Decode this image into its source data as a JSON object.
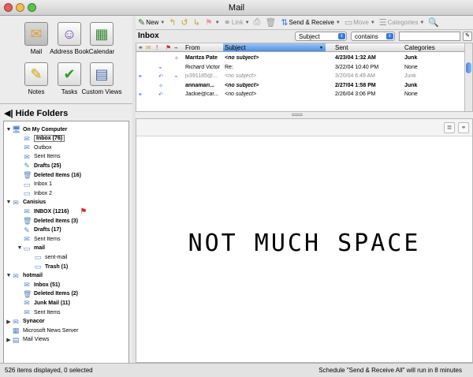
{
  "window": {
    "title": "Mail"
  },
  "apps": [
    {
      "label": "Mail",
      "icon": "inbox-icon",
      "selected": true
    },
    {
      "label": "Address Book",
      "icon": "address-book-icon"
    },
    {
      "label": "Calendar",
      "icon": "calendar-icon"
    },
    {
      "label": "Notes",
      "icon": "notes-icon"
    },
    {
      "label": "Tasks",
      "icon": "tasks-icon"
    },
    {
      "label": "Custom Views",
      "icon": "custom-views-icon"
    }
  ],
  "sidebar": {
    "hide_folders": "Hide Folders",
    "folders": [
      {
        "label": "On My Computer",
        "bold": true,
        "triangle": "▼"
      },
      {
        "label": "Inbox (76)",
        "bold": true,
        "selected": true
      },
      {
        "label": "Outbox"
      },
      {
        "label": "Sent Items"
      },
      {
        "label": "Drafts (25)",
        "bold": true
      },
      {
        "label": "Deleted Items (16)",
        "bold": true
      },
      {
        "label": "Inbox 1"
      },
      {
        "label": "Inbox 2"
      },
      {
        "label": "Canisius",
        "bold": true,
        "triangle": "▼"
      },
      {
        "label": "INBOX (1216)",
        "bold": true,
        "flag": true
      },
      {
        "label": "Deleted Items (3)",
        "bold": true
      },
      {
        "label": "Drafts (17)",
        "bold": true
      },
      {
        "label": "Sent Items"
      },
      {
        "label": "mail",
        "bold": true,
        "triangle": "▼"
      },
      {
        "label": "sent-mail"
      },
      {
        "label": "Trash (1)",
        "bold": true
      },
      {
        "label": "hotmail",
        "bold": true,
        "triangle": "▼"
      },
      {
        "label": "Inbox (51)",
        "bold": true
      },
      {
        "label": "Deleted Items (2)",
        "bold": true
      },
      {
        "label": "Junk Mail (11)",
        "bold": true
      },
      {
        "label": "Sent Items"
      },
      {
        "label": "Synacor",
        "bold": true,
        "triangle": "▶"
      },
      {
        "label": "Microsoft News Server"
      },
      {
        "label": "Mail Views",
        "triangle": "▶"
      }
    ]
  },
  "toolbar": {
    "new": "New",
    "link": "Link",
    "send_receive": "Send & Receive",
    "move": "Move",
    "categories": "Categories"
  },
  "inbox": {
    "title": "Inbox",
    "filter_field": "Subject",
    "filter_op": "contains",
    "search_value": "",
    "columns": {
      "from": "From",
      "subject": "Subject",
      "sent": "Sent",
      "categories": "Categories"
    },
    "messages": [
      {
        "from": "Maritza Pate",
        "subject": "<no subject>",
        "sent": "4/23/04 1:32 AM",
        "category": "Junk",
        "style": "bold"
      },
      {
        "from": "Richard Victor",
        "subject": "Re:",
        "sent": "3/22/04 10:40 PM",
        "category": "None",
        "style": ""
      },
      {
        "from": "jv391185@...",
        "subject": "<no subject>",
        "sent": "3/20/04 6:49 AM",
        "category": "Junk",
        "style": "gray"
      },
      {
        "from": "annamari...",
        "subject": "<no subject>",
        "sent": "2/27/04 1:58 PM",
        "category": "Junk",
        "style": "bold"
      },
      {
        "from": "Jackie@car...",
        "subject": "<no subject>",
        "sent": "2/26/04 3:06 PM",
        "category": "None",
        "style": ""
      }
    ]
  },
  "preview": {
    "text": "NOT MUCH SPACE"
  },
  "status": {
    "left": "526 items displayed, 0 selected",
    "right": "Schedule \"Send & Receive All\" will run in 8 minutes"
  },
  "colors": {
    "accent": "#3b78d8",
    "close": "#ec5b55",
    "minimize": "#f4bd4f",
    "zoom": "#5ec24a"
  }
}
